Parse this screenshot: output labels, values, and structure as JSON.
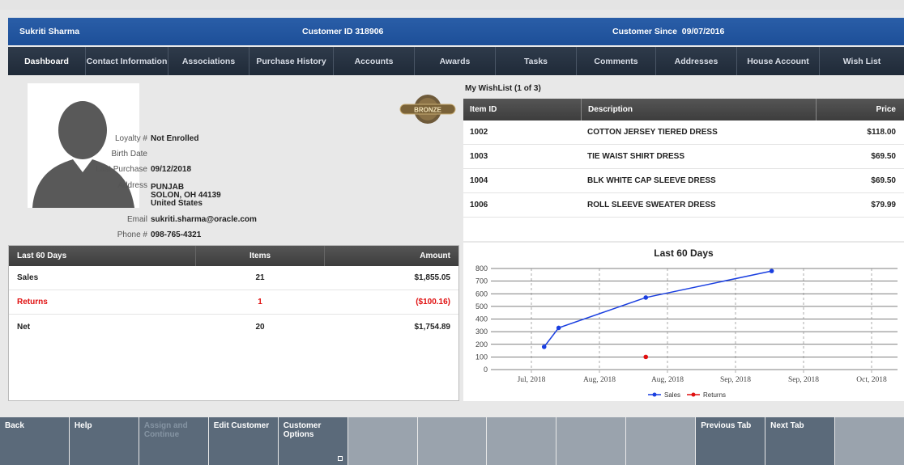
{
  "header": {
    "customer_name": "Sukriti Sharma",
    "customer_id": "Customer ID 318906",
    "customer_since_label": "Customer Since",
    "customer_since_date": "09/07/2016"
  },
  "tabs": [
    {
      "label": "Dashboard",
      "active": true
    },
    {
      "label": "Contact Information"
    },
    {
      "label": "Associations"
    },
    {
      "label": "Purchase History"
    },
    {
      "label": "Accounts"
    },
    {
      "label": "Awards"
    },
    {
      "label": "Tasks"
    },
    {
      "label": "Comments"
    },
    {
      "label": "Addresses"
    },
    {
      "label": "House Account"
    },
    {
      "label": "Wish List"
    }
  ],
  "profile": {
    "badge": "BRONZE",
    "loyalty_label": "Loyalty #",
    "loyalty_value": "Not Enrolled",
    "birth_label": "Birth Date",
    "birth_value": "",
    "last_purchase_label": "Last Purchase",
    "last_purchase_value": "09/12/2018",
    "address_label": "Address",
    "address_line1": "PUNJAB",
    "address_line2": "SOLON, OH 44139",
    "address_line3": "United States",
    "email_label": "Email",
    "email_value": "sukriti.sharma@oracle.com",
    "phone_label": "Phone #",
    "phone_value": "098-765-4321"
  },
  "stats": {
    "headers": [
      "Last 60 Days",
      "Items",
      "Amount"
    ],
    "rows": [
      {
        "label": "Sales",
        "items": "21",
        "amount": "$1,855.05"
      },
      {
        "label": "Returns",
        "items": "1",
        "amount": "($100.16)"
      },
      {
        "label": "Net",
        "items": "20",
        "amount": "$1,754.89"
      }
    ]
  },
  "wishlist": {
    "title": "My WishList (1 of 3)",
    "headers": [
      "Item ID",
      "Description",
      "Price"
    ],
    "rows": [
      {
        "id": "1002",
        "desc": "COTTON JERSEY TIERED DRESS",
        "price": "$118.00"
      },
      {
        "id": "1003",
        "desc": "TIE WAIST SHIRT DRESS",
        "price": "$69.50"
      },
      {
        "id": "1004",
        "desc": "BLK WHITE CAP SLEEVE DRESS",
        "price": "$69.50"
      },
      {
        "id": "1006",
        "desc": "ROLL SLEEVE SWEATER DRESS",
        "price": "$79.99"
      }
    ]
  },
  "chart_data": {
    "type": "line",
    "title": "Last 60 Days",
    "ylim": [
      0,
      800
    ],
    "yticks": [
      "0",
      "100",
      "200",
      "300",
      "400",
      "500",
      "600",
      "700",
      "800"
    ],
    "xticks": [
      "Jul, 2018",
      "Aug, 2018",
      "Aug, 2018",
      "Sep, 2018",
      "Sep, 2018",
      "Oct, 2018"
    ],
    "legend_position": "bottom",
    "series": [
      {
        "name": "Sales",
        "color": "#1a3fe0",
        "points": [
          {
            "x": "2018-07-27",
            "y": 180
          },
          {
            "x": "2018-07-30",
            "y": 330
          },
          {
            "x": "2018-08-17",
            "y": 570
          },
          {
            "x": "2018-09-12",
            "y": 780
          }
        ]
      },
      {
        "name": "Returns",
        "color": "#e01010",
        "points": [
          {
            "x": "2018-08-17",
            "y": 100
          }
        ]
      }
    ]
  },
  "bottom_buttons": [
    {
      "label": "Back",
      "enabled": true
    },
    {
      "label": "Help",
      "enabled": true
    },
    {
      "label": "Assign and Continue",
      "enabled": false
    },
    {
      "label": "Edit Customer",
      "enabled": true
    },
    {
      "label": "Customer Options",
      "enabled": true,
      "more": true
    },
    {
      "label": ""
    },
    {
      "label": ""
    },
    {
      "label": ""
    },
    {
      "label": ""
    },
    {
      "label": ""
    },
    {
      "label": "Previous Tab",
      "enabled": true
    },
    {
      "label": "Next Tab",
      "enabled": true
    },
    {
      "label": ""
    }
  ]
}
